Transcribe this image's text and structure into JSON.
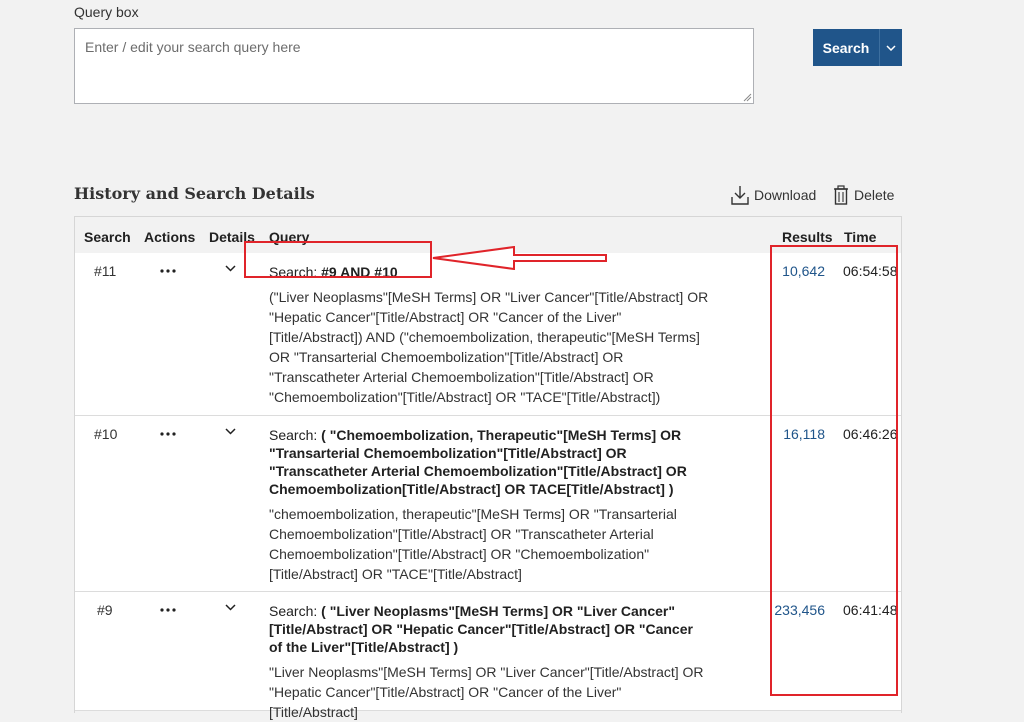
{
  "query_box": {
    "label": "Query box",
    "placeholder": "Enter / edit your search query here"
  },
  "search_button": {
    "label": "Search"
  },
  "history": {
    "title": "History and Search Details",
    "download_label": "Download",
    "delete_label": "Delete",
    "columns": {
      "search": "Search",
      "actions": "Actions",
      "details": "Details",
      "query": "Query",
      "results": "Results",
      "time": "Time"
    },
    "rows": [
      {
        "number": "#11",
        "search_prefix": "Search: ",
        "search_query": "#9 AND #10",
        "detail": "(\"Liver Neoplasms\"[MeSH Terms] OR \"Liver Cancer\"[Title/Abstract] OR \"Hepatic Cancer\"[Title/Abstract] OR \"Cancer of the Liver\"[Title/Abstract]) AND (\"chemoembolization, therapeutic\"[MeSH Terms] OR \"Transarterial Chemoembolization\"[Title/Abstract] OR \"Transcatheter Arterial Chemoembolization\"[Title/Abstract] OR \"Chemoembolization\"[Title/Abstract] OR \"TACE\"[Title/Abstract])",
        "results": "10,642",
        "time": "06:54:58"
      },
      {
        "number": "#10",
        "search_prefix": "Search: ",
        "search_query": "( \"Chemoembolization, Therapeutic\"[MeSH Terms] OR \"Transarterial Chemoembolization\"[Title/Abstract] OR \"Transcatheter Arterial Chemoembolization\"[Title/Abstract] OR Chemoembolization[Title/Abstract] OR TACE[Title/Abstract] )",
        "detail": "\"chemoembolization, therapeutic\"[MeSH Terms] OR \"Transarterial Chemoembolization\"[Title/Abstract] OR \"Transcatheter Arterial Chemoembolization\"[Title/Abstract] OR \"Chemoembolization\"[Title/Abstract] OR \"TACE\"[Title/Abstract]",
        "results": "16,118",
        "time": "06:46:26"
      },
      {
        "number": "#9",
        "search_prefix": "Search: ",
        "search_query": "( \"Liver Neoplasms\"[MeSH Terms] OR \"Liver Cancer\"[Title/Abstract] OR \"Hepatic Cancer\"[Title/Abstract] OR \"Cancer of the Liver\"[Title/Abstract] )",
        "detail": "\"Liver Neoplasms\"[MeSH Terms] OR \"Liver Cancer\"[Title/Abstract] OR \"Hepatic Cancer\"[Title/Abstract] OR \"Cancer of the Liver\"[Title/Abstract]",
        "results": "233,456",
        "time": "06:41:48"
      }
    ]
  },
  "colors": {
    "primary": "#20558a",
    "annotation": "#e0242a",
    "link": "#20558a"
  }
}
